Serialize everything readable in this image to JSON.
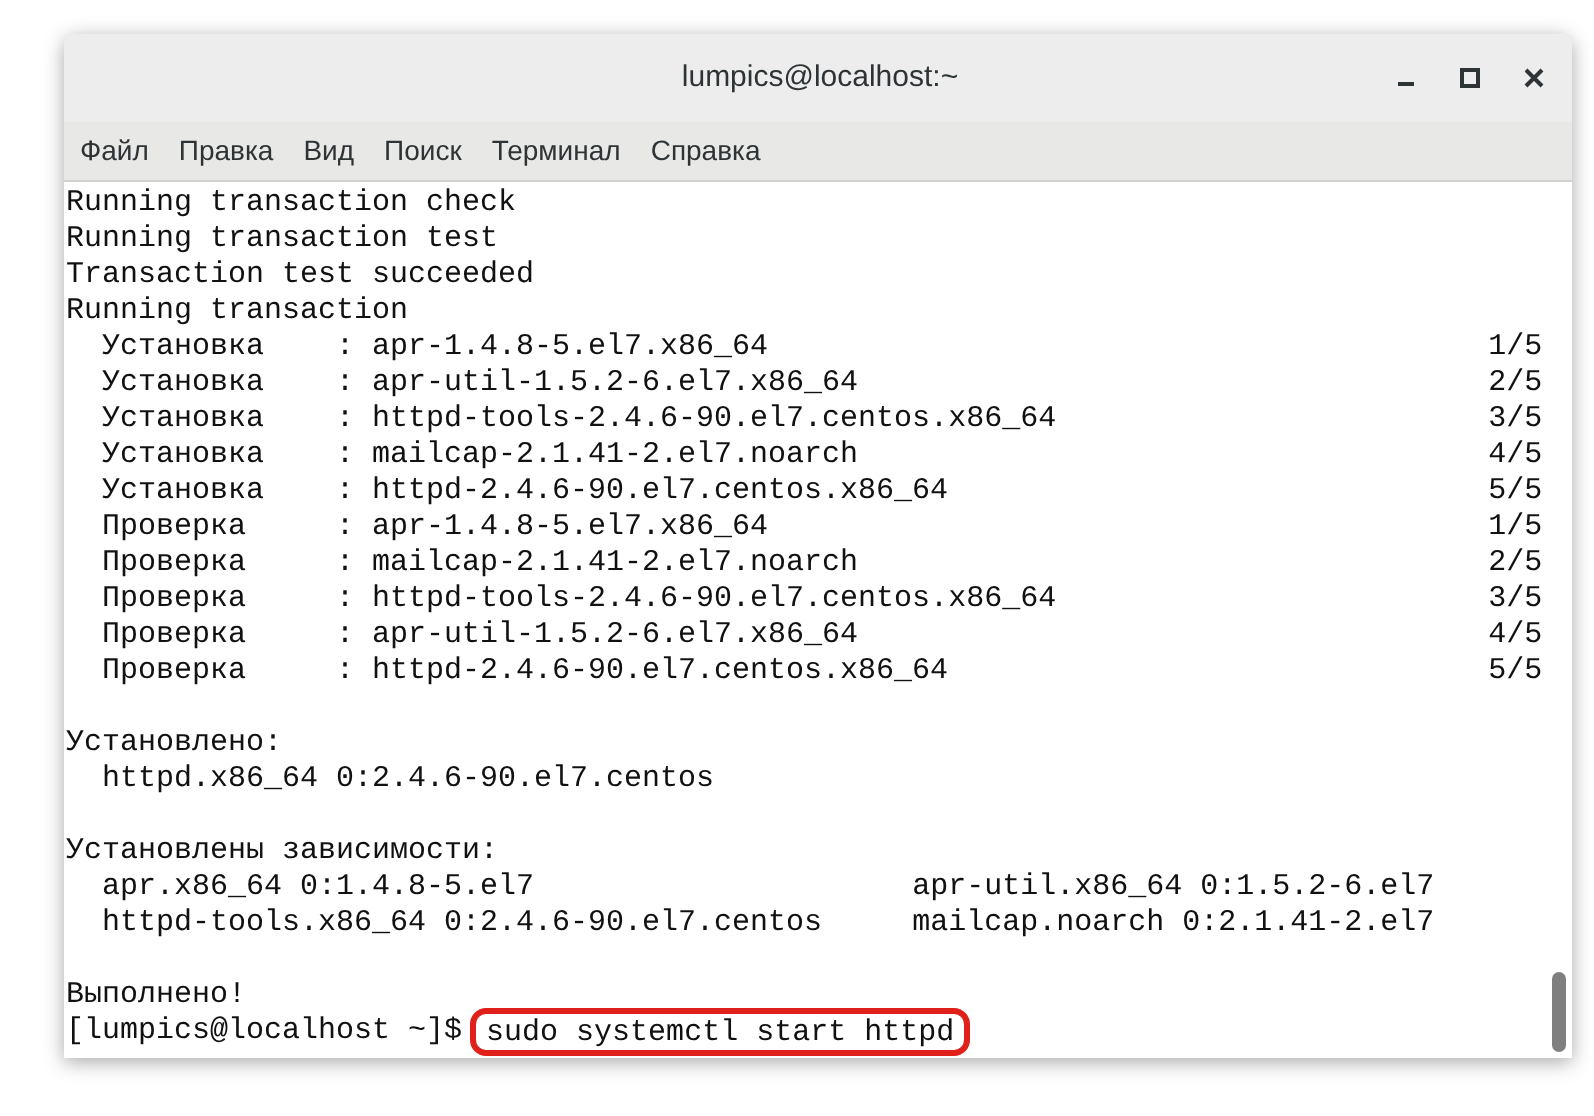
{
  "window": {
    "title": "lumpics@localhost:~"
  },
  "menu": [
    "Файл",
    "Правка",
    "Вид",
    "Поиск",
    "Терминал",
    "Справка"
  ],
  "terminal": {
    "lines": [
      {
        "kind": "text",
        "text": "Running transaction check"
      },
      {
        "kind": "text",
        "text": "Running transaction test"
      },
      {
        "kind": "text",
        "text": "Transaction test succeeded"
      },
      {
        "kind": "text",
        "text": "Running transaction"
      },
      {
        "kind": "step",
        "action": "Установка",
        "separator": ":",
        "package": "apr-1.4.8-5.el7.x86_64",
        "count": "1/5"
      },
      {
        "kind": "step",
        "action": "Установка",
        "separator": ":",
        "package": "apr-util-1.5.2-6.el7.x86_64",
        "count": "2/5"
      },
      {
        "kind": "step",
        "action": "Установка",
        "separator": ":",
        "package": "httpd-tools-2.4.6-90.el7.centos.x86_64",
        "count": "3/5"
      },
      {
        "kind": "step",
        "action": "Установка",
        "separator": ":",
        "package": "mailcap-2.1.41-2.el7.noarch",
        "count": "4/5"
      },
      {
        "kind": "step",
        "action": "Установка",
        "separator": ":",
        "package": "httpd-2.4.6-90.el7.centos.x86_64",
        "count": "5/5"
      },
      {
        "kind": "step",
        "action": "Проверка",
        "separator": ":",
        "package": "apr-1.4.8-5.el7.x86_64",
        "count": "1/5"
      },
      {
        "kind": "step",
        "action": "Проверка",
        "separator": ":",
        "package": "mailcap-2.1.41-2.el7.noarch",
        "count": "2/5"
      },
      {
        "kind": "step",
        "action": "Проверка",
        "separator": ":",
        "package": "httpd-tools-2.4.6-90.el7.centos.x86_64",
        "count": "3/5"
      },
      {
        "kind": "step",
        "action": "Проверка",
        "separator": ":",
        "package": "apr-util-1.5.2-6.el7.x86_64",
        "count": "4/5"
      },
      {
        "kind": "step",
        "action": "Проверка",
        "separator": ":",
        "package": "httpd-2.4.6-90.el7.centos.x86_64",
        "count": "5/5"
      },
      {
        "kind": "blank"
      },
      {
        "kind": "text",
        "text": "Установлено:"
      },
      {
        "kind": "indent",
        "text": "httpd.x86_64 0:2.4.6-90.el7.centos"
      },
      {
        "kind": "blank"
      },
      {
        "kind": "text",
        "text": "Установлены зависимости:"
      },
      {
        "kind": "pair",
        "left": "apr.x86_64 0:1.4.8-5.el7",
        "right": "apr-util.x86_64 0:1.5.2-6.el7"
      },
      {
        "kind": "pair",
        "left": "httpd-tools.x86_64 0:2.4.6-90.el7.centos",
        "right": "mailcap.noarch 0:2.1.41-2.el7"
      },
      {
        "kind": "blank"
      },
      {
        "kind": "text",
        "text": "Выполнено!"
      },
      {
        "kind": "prompt",
        "prompt": "[lumpics@localhost ~]$",
        "command": "sudo systemctl start httpd",
        "highlighted": true
      }
    ]
  }
}
